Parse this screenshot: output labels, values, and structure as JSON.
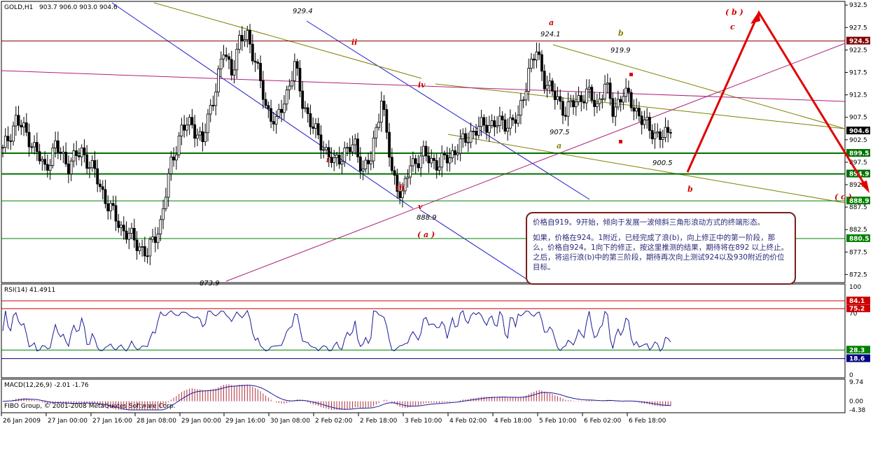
{
  "header": {
    "symbol": "GOLD,H1",
    "ohlc": "903.7 906.0 903.0 904.6"
  },
  "chart_data": {
    "type": "candlestick",
    "symbol": "GOLD",
    "timeframe": "H1",
    "ylim": [
      871.0,
      933.0
    ],
    "price_ticks": [
      "932.5",
      "927.5",
      "922.5",
      "917.5",
      "912.5",
      "907.5",
      "902.5",
      "897.5",
      "892.5",
      "887.5",
      "882.5",
      "877.5",
      "872.5"
    ],
    "time_labels": [
      "26 Jan 2009",
      "27 Jan 00:00",
      "27 Jan 16:00",
      "28 Jan 08:00",
      "29 Jan 00:00",
      "29 Jan 16:00",
      "30 Jan 08:00",
      "2 Feb 02:00",
      "2 Feb 18:00",
      "3 Feb 10:00",
      "4 Feb 02:00",
      "4 Feb 18:00",
      "5 Feb 10:00",
      "6 Feb 02:00",
      "6 Feb 18:00"
    ],
    "close_anchors": [
      [
        0,
        900
      ],
      [
        5,
        907
      ],
      [
        10,
        903
      ],
      [
        16,
        896
      ],
      [
        20,
        901
      ],
      [
        25,
        897
      ],
      [
        30,
        900
      ],
      [
        35,
        895
      ],
      [
        40,
        888
      ],
      [
        45,
        883
      ],
      [
        50,
        880
      ],
      [
        55,
        877
      ],
      [
        60,
        884
      ],
      [
        64,
        897
      ],
      [
        68,
        905
      ],
      [
        72,
        906
      ],
      [
        76,
        902
      ],
      [
        80,
        912
      ],
      [
        84,
        922
      ],
      [
        87,
        918
      ],
      [
        90,
        924
      ],
      [
        93,
        926
      ],
      [
        96,
        920
      ],
      [
        100,
        910
      ],
      [
        104,
        906
      ],
      [
        108,
        913
      ],
      [
        111,
        919
      ],
      [
        114,
        911
      ],
      [
        118,
        905
      ],
      [
        122,
        901
      ],
      [
        126,
        897
      ],
      [
        130,
        900
      ],
      [
        134,
        901
      ],
      [
        137,
        896
      ],
      [
        140,
        898
      ],
      [
        144,
        912
      ],
      [
        148,
        895
      ],
      [
        152,
        890
      ],
      [
        155,
        897
      ],
      [
        160,
        899
      ],
      [
        166,
        897
      ],
      [
        172,
        900
      ],
      [
        178,
        904
      ],
      [
        184,
        906
      ],
      [
        190,
        906
      ],
      [
        196,
        907
      ],
      [
        200,
        918
      ],
      [
        203,
        922
      ],
      [
        206,
        916
      ],
      [
        210,
        912
      ],
      [
        214,
        909
      ],
      [
        218,
        911
      ],
      [
        222,
        913
      ],
      [
        226,
        910
      ],
      [
        229,
        915
      ],
      [
        232,
        909
      ],
      [
        236,
        913
      ],
      [
        240,
        910
      ],
      [
        244,
        906
      ],
      [
        248,
        904
      ],
      [
        251,
        903
      ],
      [
        254,
        904
      ]
    ],
    "levels": [
      {
        "value": "924.5",
        "color": "#800000"
      },
      {
        "value": "899.5",
        "color": "#007000"
      },
      {
        "value": "894.9",
        "color": "#007000"
      },
      {
        "value": "888.9",
        "color": "#008000"
      },
      {
        "value": "880.5",
        "color": "#008000"
      }
    ],
    "last_price": "904.6",
    "wave_labels": {
      "ii": "ii",
      "i": "i",
      "iii": "iii",
      "iv": "iv",
      "v": "v",
      "a_paren": "( a )",
      "a": "a",
      "b": "b",
      "b_lower": "b",
      "a_lower": "a",
      "c": "c",
      "b_paren": "( b )",
      "c_paren": "( c )"
    },
    "price_labels": {
      "p929": "929.4",
      "p888": "888.9",
      "p873": "873.9",
      "p924": "924.1",
      "p919": "919.9",
      "p907": "907.5",
      "p900": "900.5"
    },
    "rsi": {
      "label": "RSI(14) 41.4911",
      "ticks": [
        "100",
        "70",
        "30",
        "0"
      ],
      "levels": [
        {
          "value": "84.1",
          "color": "#cc0000"
        },
        {
          "value": "75.2",
          "color": "#cc0000"
        },
        {
          "value": "28.3",
          "color": "#008000"
        },
        {
          "value": "18.6",
          "color": "#000080"
        }
      ]
    },
    "macd": {
      "label": "MACD(12,26,9) -2.01 -1.76",
      "ticks": [
        "9.74",
        "0.00",
        "-4.38"
      ]
    }
  },
  "footer": {
    "copyright": "FIBO Group, © 2001-2008 MetaQuotes Software Corp."
  },
  "note": {
    "p1": "价格自919。9开始，倾向于发展一波倾斜三角形浪动方式的终端形态。",
    "p2": "如果，价格在924。1附近，已经完成了浪(b)，向上修正中的第一阶段，那么，价格自924。1向下的修正，按这里推测的结果，期待将在892 以上终止。之后，将运行浪(b)中的第三阶段，期待再次向上测试924以及930附近的价位目标。"
  }
}
